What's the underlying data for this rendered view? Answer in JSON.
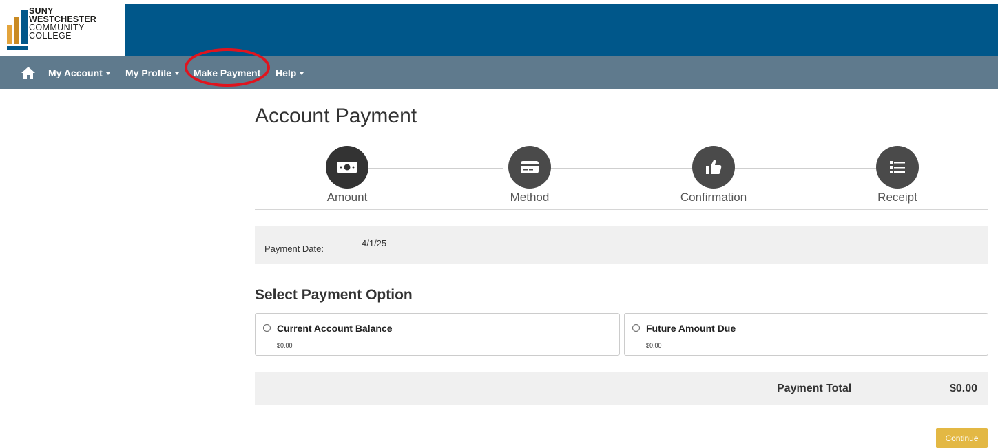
{
  "logo": {
    "line1": "SUNY",
    "line2": "WESTCHESTER",
    "line3": "COMMUNITY",
    "line4": "COLLEGE"
  },
  "nav": {
    "home_icon": "home-icon",
    "items": [
      {
        "label": "My Account",
        "has_dropdown": true
      },
      {
        "label": "My Profile",
        "has_dropdown": true
      },
      {
        "label": "Make Payment",
        "has_dropdown": false
      },
      {
        "label": "Help",
        "has_dropdown": true
      }
    ]
  },
  "page": {
    "title": "Account Payment"
  },
  "steps": [
    {
      "label": "Amount",
      "icon": "money-bill-icon",
      "active": true
    },
    {
      "label": "Method",
      "icon": "credit-card-icon",
      "active": false
    },
    {
      "label": "Confirmation",
      "icon": "thumbs-up-icon",
      "active": false
    },
    {
      "label": "Receipt",
      "icon": "list-icon",
      "active": false
    }
  ],
  "payment_date": {
    "label": "Payment Date:",
    "value": "4/1/25"
  },
  "options": {
    "heading": "Select Payment Option",
    "items": [
      {
        "title": "Current Account Balance",
        "amount": "$0.00"
      },
      {
        "title": "Future Amount Due",
        "amount": "$0.00"
      }
    ]
  },
  "total": {
    "label": "Payment Total",
    "value": "$0.00"
  },
  "actions": {
    "continue_label": "Continue"
  },
  "colors": {
    "header": "#00578a",
    "navbar": "#5f7a8d",
    "continue": "#e3b844",
    "highlight_ring": "#e0141e"
  }
}
